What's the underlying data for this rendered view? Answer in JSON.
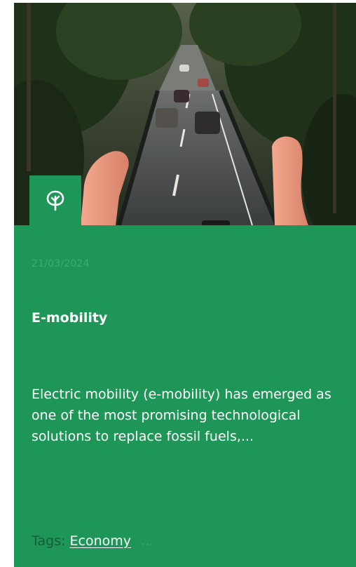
{
  "post": {
    "category_icon": "tree-icon",
    "date": "21/03/2024",
    "title": "E-mobility",
    "excerpt": "Electric mobility (e-mobility) has emerged as one of the most promising technological solutions to replace fossil fuels,...",
    "tags_label": "Tags:",
    "tags": [
      "Economy"
    ],
    "tags_more": "..."
  },
  "colors": {
    "card_background": "#1e9657",
    "text": "#ffffff",
    "muted_text": "#165c38"
  }
}
